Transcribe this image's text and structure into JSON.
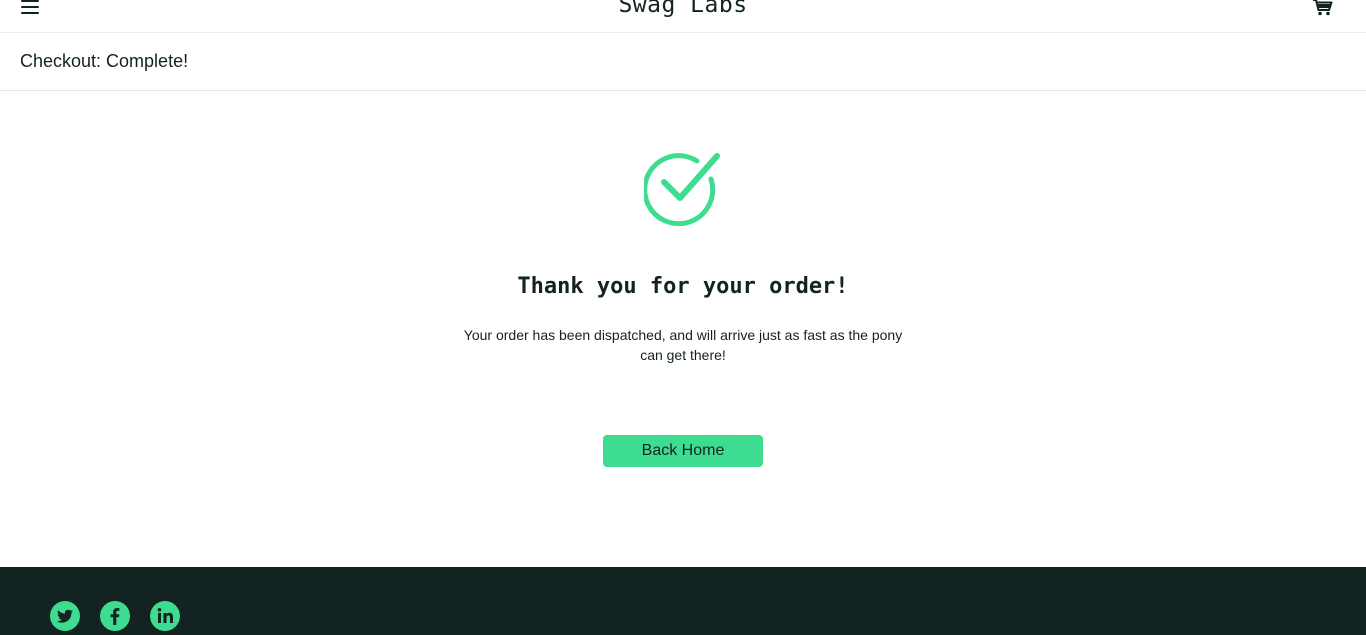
{
  "header": {
    "app_logo": "Swag Labs",
    "menu_icon": "hamburger-menu-icon",
    "cart_icon": "shopping-cart-icon"
  },
  "secondary_header": {
    "title": "Checkout: Complete!"
  },
  "complete": {
    "icon": "checkmark-icon",
    "header": "Thank you for your order!",
    "text": "Your order has been dispatched, and will arrive just as fast as the pony can get there!",
    "back_home_label": "Back Home"
  },
  "footer": {
    "social_links": [
      {
        "name": "twitter-icon"
      },
      {
        "name": "facebook-icon"
      },
      {
        "name": "linkedin-icon"
      }
    ]
  },
  "colors": {
    "accent": "#3ddc91",
    "dark": "#132322",
    "background": "#ffffff"
  }
}
